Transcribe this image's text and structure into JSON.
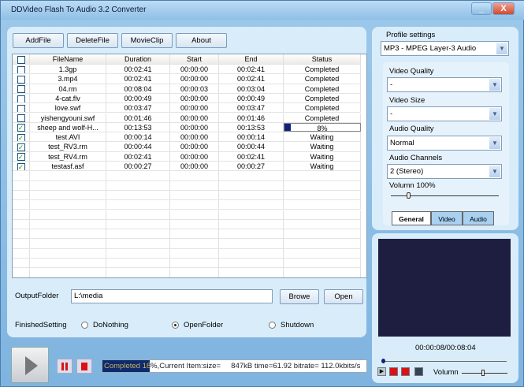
{
  "window": {
    "title": "DDVideo Flash To Audio 3.2 Converter",
    "minimize": "_",
    "close": "X"
  },
  "toolbar": {
    "add": "AddFile",
    "delete": "DeleteFile",
    "movieclip": "MovieClip",
    "about": "About"
  },
  "table": {
    "headers": [
      "FileName",
      "Duration",
      "Start",
      "End",
      "Status"
    ],
    "rows": [
      {
        "checked": false,
        "name": "1.3gp",
        "duration": "00:02:41",
        "start": "00:00:00",
        "end": "00:02:41",
        "status": "Completed"
      },
      {
        "checked": false,
        "name": "3.mp4",
        "duration": "00:02:41",
        "start": "00:00:00",
        "end": "00:02:41",
        "status": "Completed"
      },
      {
        "checked": false,
        "name": "04.rm",
        "duration": "00:08:04",
        "start": "00:00:03",
        "end": "00:03:04",
        "status": "Completed"
      },
      {
        "checked": false,
        "name": "4-cat.flv",
        "duration": "00:00:49",
        "start": "00:00:00",
        "end": "00:00:49",
        "status": "Completed"
      },
      {
        "checked": false,
        "name": "love.swf",
        "duration": "00:03:47",
        "start": "00:00:00",
        "end": "00:03:47",
        "status": "Completed"
      },
      {
        "checked": false,
        "name": "yishengyouni.swf",
        "duration": "00:01:46",
        "start": "00:00:00",
        "end": "00:01:46",
        "status": "Completed"
      },
      {
        "checked": true,
        "name": "sheep and wolf-H...",
        "duration": "00:13:53",
        "start": "00:00:00",
        "end": "00:13:53",
        "status": "8%",
        "progress": 8
      },
      {
        "checked": true,
        "name": "test.AVI",
        "duration": "00:00:14",
        "start": "00:00:00",
        "end": "00:00:14",
        "status": "Waiting"
      },
      {
        "checked": true,
        "name": "test_RV3.rm",
        "duration": "00:00:44",
        "start": "00:00:00",
        "end": "00:00:44",
        "status": "Waiting"
      },
      {
        "checked": true,
        "name": "test_RV4.rm",
        "duration": "00:02:41",
        "start": "00:00:00",
        "end": "00:02:41",
        "status": "Waiting"
      },
      {
        "checked": true,
        "name": "testasf.asf",
        "duration": "00:00:27",
        "start": "00:00:00",
        "end": "00:00:27",
        "status": "Waiting"
      }
    ]
  },
  "output": {
    "label": "OutputFolder",
    "value": "L:\\media",
    "browse": "Browe",
    "open": "Open"
  },
  "finished": {
    "label": "FinishedSetting",
    "options": [
      "DoNothing",
      "OpenFolder",
      "Shutdown"
    ],
    "selected": 1
  },
  "status": {
    "text": "Completed 18%,Current Item:size=     847kB time=61.92 bitrate= 112.0kbits/s",
    "progress": 18
  },
  "profile": {
    "label": "Profile settings",
    "value": "MP3 - MPEG Layer-3 Audio",
    "video_quality_label": "Video Quality",
    "video_quality": "-",
    "video_size_label": "Video Size",
    "video_size": "-",
    "audio_quality_label": "Audio Quality",
    "audio_quality": "Normal",
    "audio_channels_label": "Audio Channels",
    "audio_channels": "2 (Stereo)",
    "volume_label": "Volumn 100%",
    "volume": 100,
    "tabs": [
      "General",
      "Video",
      "Audio"
    ]
  },
  "preview": {
    "time": "00:00:08/00:08:04",
    "volume_label": "Volumn"
  }
}
